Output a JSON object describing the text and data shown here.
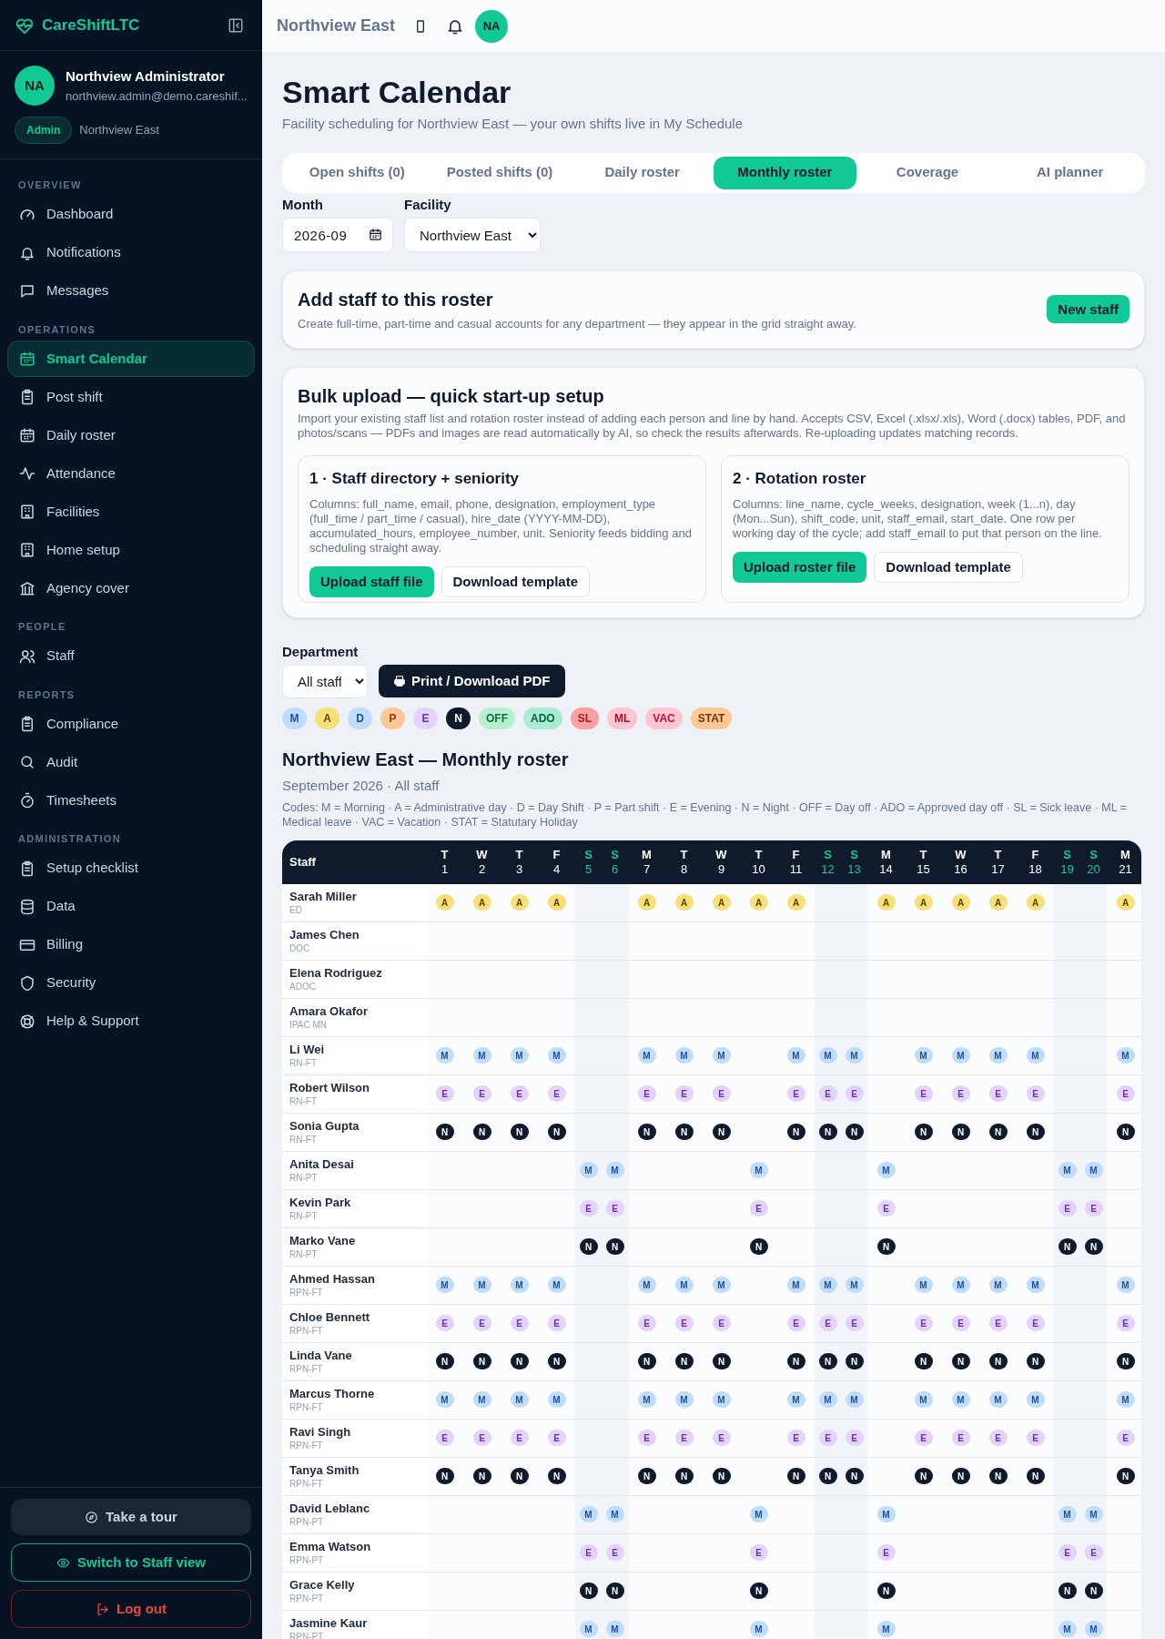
{
  "brand": "CareShiftLTC",
  "user": {
    "initials": "NA",
    "name": "Northview Administrator",
    "email": "northview.admin@demo.careshif...",
    "role": "Admin",
    "facility": "Northview East"
  },
  "sidebar": {
    "sections": [
      {
        "title": "OVERVIEW",
        "items": [
          {
            "label": "Dashboard",
            "selected": false
          },
          {
            "label": "Notifications",
            "selected": false
          },
          {
            "label": "Messages",
            "selected": false
          }
        ]
      },
      {
        "title": "OPERATIONS",
        "items": [
          {
            "label": "Smart Calendar",
            "selected": true
          },
          {
            "label": "Post shift",
            "selected": false
          },
          {
            "label": "Daily roster",
            "selected": false
          },
          {
            "label": "Attendance",
            "selected": false
          },
          {
            "label": "Facilities",
            "selected": false
          },
          {
            "label": "Home setup",
            "selected": false
          },
          {
            "label": "Agency cover",
            "selected": false
          }
        ]
      },
      {
        "title": "PEOPLE",
        "items": [
          {
            "label": "Staff",
            "selected": false
          }
        ]
      },
      {
        "title": "REPORTS",
        "items": [
          {
            "label": "Compliance",
            "selected": false
          },
          {
            "label": "Audit",
            "selected": false
          },
          {
            "label": "Timesheets",
            "selected": false
          }
        ]
      },
      {
        "title": "ADMINISTRATION",
        "items": [
          {
            "label": "Setup checklist",
            "selected": false
          },
          {
            "label": "Data",
            "selected": false
          },
          {
            "label": "Billing",
            "selected": false
          },
          {
            "label": "Security",
            "selected": false
          },
          {
            "label": "Help & Support",
            "selected": false
          }
        ]
      }
    ],
    "buttons": [
      {
        "label": "Take a tour",
        "kind": "tour"
      },
      {
        "label": "Switch to Staff view",
        "kind": "switch"
      },
      {
        "label": "Log out",
        "kind": "logout"
      }
    ]
  },
  "topbar": {
    "facility": "Northview East",
    "avatar": "NA"
  },
  "page": {
    "title": "Smart Calendar",
    "subtitle": "Facility scheduling for Northview East — your own shifts live in My Schedule"
  },
  "tabs": [
    {
      "label": "Open shifts (0)",
      "selected": false
    },
    {
      "label": "Posted shifts (0)",
      "selected": false
    },
    {
      "label": "Daily roster",
      "selected": false
    },
    {
      "label": "Monthly roster",
      "selected": true
    },
    {
      "label": "Coverage",
      "selected": false
    },
    {
      "label": "AI planner",
      "selected": false
    }
  ],
  "filters": {
    "month_label": "Month",
    "month": "2026-09",
    "facility_label": "Facility",
    "facility": "Northview East"
  },
  "add_staff": {
    "title": "Add staff to this roster",
    "text": "Create full-time, part-time and casual accounts for any department — they appear in the grid straight away.",
    "button": "New staff"
  },
  "bulk_upload": {
    "title": "Bulk upload — quick start-up setup",
    "text": "Import your existing staff list and rotation roster instead of adding each person and line by hand. Accepts CSV, Excel (.xlsx/.xls), Word (.docx) tables, PDF, and photos/scans — PDFs and images are read automatically by AI, so check the results afterwards. Re-uploading updates matching records.",
    "cards": [
      {
        "title": "1 · Staff directory + seniority",
        "text": "Columns: full_name, email, phone, designation, employment_type (full_time / part_time / casual), hire_date (YYYY-MM-DD), accumulated_hours, employee_number, unit. Seniority feeds bidding and scheduling straight away.",
        "upload": "Upload staff file",
        "template": "Download template"
      },
      {
        "title": "2 · Rotation roster",
        "text": "Columns: line_name, cycle_weeks, designation, week (1...n), day (Mon...Sun), shift_code, unit, staff_email, start_date. One row per working day of the cycle; add staff_email to put that person on the line.",
        "upload": "Upload roster file",
        "template": "Download template"
      }
    ]
  },
  "department": {
    "label": "Department",
    "value": "All staff",
    "print": "Print / Download PDF"
  },
  "legend": [
    {
      "code": "M",
      "kind": "morning"
    },
    {
      "code": "A",
      "kind": "admin"
    },
    {
      "code": "D",
      "kind": "day"
    },
    {
      "code": "P",
      "kind": "part"
    },
    {
      "code": "E",
      "kind": "evening"
    },
    {
      "code": "N",
      "kind": "night"
    },
    {
      "code": "OFF",
      "kind": "off"
    },
    {
      "code": "ADO",
      "kind": "ado"
    },
    {
      "code": "SL",
      "kind": "sick"
    },
    {
      "code": "ML",
      "kind": "medical"
    },
    {
      "code": "VAC",
      "kind": "vacation"
    },
    {
      "code": "STAT",
      "kind": "stat"
    }
  ],
  "roster": {
    "title": "Northview East — Monthly roster",
    "subtitle": "September 2026 · All staff",
    "codes": "Codes: M = Morning · A = Administrative day · D = Day Shift · P = Part shift · E = Evening · N = Night · OFF = Day off · ADO = Approved day off · SL = Sick leave · ML = Medical leave · VAC = Vacation · STAT = Statutary Holiday",
    "staff_header": "Staff",
    "days": [
      {
        "dow": "T",
        "date": "1",
        "weekend": false
      },
      {
        "dow": "W",
        "date": "2",
        "weekend": false
      },
      {
        "dow": "T",
        "date": "3",
        "weekend": false
      },
      {
        "dow": "F",
        "date": "4",
        "weekend": false
      },
      {
        "dow": "S",
        "date": "5",
        "weekend": true
      },
      {
        "dow": "S",
        "date": "6",
        "weekend": true
      },
      {
        "dow": "M",
        "date": "7",
        "weekend": false
      },
      {
        "dow": "T",
        "date": "8",
        "weekend": false
      },
      {
        "dow": "W",
        "date": "9",
        "weekend": false
      },
      {
        "dow": "T",
        "date": "10",
        "weekend": false
      },
      {
        "dow": "F",
        "date": "11",
        "weekend": false
      },
      {
        "dow": "S",
        "date": "12",
        "weekend": true
      },
      {
        "dow": "S",
        "date": "13",
        "weekend": true
      },
      {
        "dow": "M",
        "date": "14",
        "weekend": false
      },
      {
        "dow": "T",
        "date": "15",
        "weekend": false
      },
      {
        "dow": "W",
        "date": "16",
        "weekend": false
      },
      {
        "dow": "T",
        "date": "17",
        "weekend": false
      },
      {
        "dow": "F",
        "date": "18",
        "weekend": false
      },
      {
        "dow": "S",
        "date": "19",
        "weekend": true
      },
      {
        "dow": "S",
        "date": "20",
        "weekend": true
      },
      {
        "dow": "M",
        "date": "21",
        "weekend": false
      }
    ],
    "rows": [
      {
        "name": "Sarah Miller",
        "role": "ED",
        "kind": "admin",
        "cells": [
          "A",
          "A",
          "A",
          "A",
          null,
          null,
          "A",
          "A",
          "A",
          "A",
          "A",
          null,
          null,
          "A",
          "A",
          "A",
          "A",
          "A",
          null,
          null,
          "A"
        ]
      },
      {
        "name": "James Chen",
        "role": "DOC"
      },
      {
        "name": "Elena Rodriguez",
        "role": "ADOC"
      },
      {
        "name": "Amara Okafor",
        "role": "IPAC MN"
      },
      {
        "name": "Li Wei",
        "role": "RN-FT",
        "kind": "morning",
        "cells": [
          "M",
          "M",
          "M",
          "M",
          null,
          null,
          "M",
          "M",
          "M",
          null,
          "M",
          "M",
          "M",
          null,
          "M",
          "M",
          "M",
          "M",
          null,
          null,
          "M"
        ]
      },
      {
        "name": "Robert Wilson",
        "role": "RN-FT",
        "kind": "evening",
        "cells": [
          "E",
          "E",
          "E",
          "E",
          null,
          null,
          "E",
          "E",
          "E",
          null,
          "E",
          "E",
          "E",
          null,
          "E",
          "E",
          "E",
          "E",
          null,
          null,
          "E"
        ]
      },
      {
        "name": "Sonia Gupta",
        "role": "RN-FT",
        "kind": "night",
        "cells": [
          "N",
          "N",
          "N",
          "N",
          null,
          null,
          "N",
          "N",
          "N",
          null,
          "N",
          "N",
          "N",
          null,
          "N",
          "N",
          "N",
          "N",
          null,
          null,
          "N"
        ]
      },
      {
        "name": "Anita Desai",
        "role": "RN-PT",
        "kind": "morning",
        "cells": [
          null,
          null,
          null,
          null,
          "M",
          "M",
          null,
          null,
          null,
          "M",
          null,
          null,
          null,
          "M",
          null,
          null,
          null,
          null,
          "M",
          "M",
          null
        ]
      },
      {
        "name": "Kevin Park",
        "role": "RN-PT",
        "kind": "evening",
        "cells": [
          null,
          null,
          null,
          null,
          "E",
          "E",
          null,
          null,
          null,
          "E",
          null,
          null,
          null,
          "E",
          null,
          null,
          null,
          null,
          "E",
          "E",
          null
        ]
      },
      {
        "name": "Marko Vane",
        "role": "RN-PT",
        "kind": "night",
        "cells": [
          null,
          null,
          null,
          null,
          "N",
          "N",
          null,
          null,
          null,
          "N",
          null,
          null,
          null,
          "N",
          null,
          null,
          null,
          null,
          "N",
          "N",
          null
        ]
      },
      {
        "name": "Ahmed Hassan",
        "role": "RPN-FT",
        "kind": "morning",
        "cells": [
          "M",
          "M",
          "M",
          "M",
          null,
          null,
          "M",
          "M",
          "M",
          null,
          "M",
          "M",
          "M",
          null,
          "M",
          "M",
          "M",
          "M",
          null,
          null,
          "M"
        ]
      },
      {
        "name": "Chloe Bennett",
        "role": "RPN-FT",
        "kind": "evening",
        "cells": [
          "E",
          "E",
          "E",
          "E",
          null,
          null,
          "E",
          "E",
          "E",
          null,
          "E",
          "E",
          "E",
          null,
          "E",
          "E",
          "E",
          "E",
          null,
          null,
          "E"
        ]
      },
      {
        "name": "Linda Vane",
        "role": "RPN-FT",
        "kind": "night",
        "cells": [
          "N",
          "N",
          "N",
          "N",
          null,
          null,
          "N",
          "N",
          "N",
          null,
          "N",
          "N",
          "N",
          null,
          "N",
          "N",
          "N",
          "N",
          null,
          null,
          "N"
        ]
      },
      {
        "name": "Marcus Thorne",
        "role": "RPN-FT",
        "kind": "morning",
        "cells": [
          "M",
          "M",
          "M",
          "M",
          null,
          null,
          "M",
          "M",
          "M",
          null,
          "M",
          "M",
          "M",
          null,
          "M",
          "M",
          "M",
          "M",
          null,
          null,
          "M"
        ]
      },
      {
        "name": "Ravi Singh",
        "role": "RPN-FT",
        "kind": "evening",
        "cells": [
          "E",
          "E",
          "E",
          "E",
          null,
          null,
          "E",
          "E",
          "E",
          null,
          "E",
          "E",
          "E",
          null,
          "E",
          "E",
          "E",
          "E",
          null,
          null,
          "E"
        ]
      },
      {
        "name": "Tanya Smith",
        "role": "RPN-FT",
        "kind": "night",
        "cells": [
          "N",
          "N",
          "N",
          "N",
          null,
          null,
          "N",
          "N",
          "N",
          null,
          "N",
          "N",
          "N",
          null,
          "N",
          "N",
          "N",
          "N",
          null,
          null,
          "N"
        ]
      },
      {
        "name": "David Leblanc",
        "role": "RPN-PT",
        "kind": "morning",
        "cells": [
          null,
          null,
          null,
          null,
          "M",
          "M",
          null,
          null,
          null,
          "M",
          null,
          null,
          null,
          "M",
          null,
          null,
          null,
          null,
          "M",
          "M",
          null
        ]
      },
      {
        "name": "Emma Watson",
        "role": "RPN-PT",
        "kind": "evening",
        "cells": [
          null,
          null,
          null,
          null,
          "E",
          "E",
          null,
          null,
          null,
          "E",
          null,
          null,
          null,
          "E",
          null,
          null,
          null,
          null,
          "E",
          "E",
          null
        ]
      },
      {
        "name": "Grace Kelly",
        "role": "RPN-PT",
        "kind": "night",
        "cells": [
          null,
          null,
          null,
          null,
          "N",
          "N",
          null,
          null,
          null,
          "N",
          null,
          null,
          null,
          "N",
          null,
          null,
          null,
          null,
          "N",
          "N",
          null
        ]
      },
      {
        "name": "Jasmine Kaur",
        "role": "RPN-PT",
        "kind": "morning",
        "cells": [
          null,
          null,
          null,
          null,
          "M",
          "M",
          null,
          null,
          null,
          "M",
          null,
          null,
          null,
          "M",
          null,
          null,
          null,
          null,
          "M",
          "M",
          null
        ]
      }
    ]
  }
}
